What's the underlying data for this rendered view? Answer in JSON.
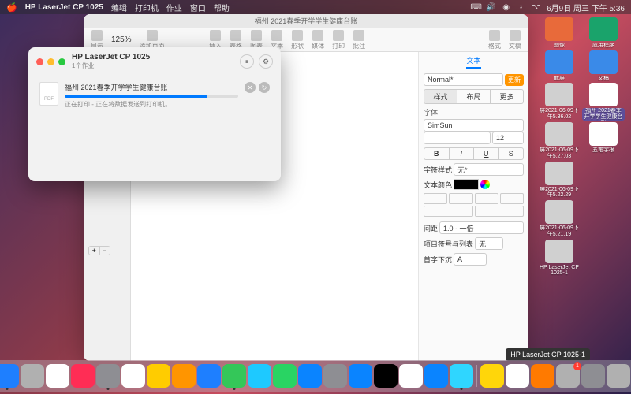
{
  "menubar": {
    "app": "HP LaserJet CP 1025",
    "menus": [
      "编辑",
      "打印机",
      "作业",
      "窗口",
      "帮助"
    ],
    "date": "6月9日 周三 下午 5:36"
  },
  "pages": {
    "title": "福州 2021春季开学学生健康台账",
    "zoom": "125%",
    "toolbar": [
      "显示",
      "125%",
      "添加页面",
      "插入",
      "表格",
      "图表",
      "文本",
      "形状",
      "媒体",
      "打印",
      "批注",
      "格式",
      "文稿"
    ],
    "inspector": {
      "top_tab": "文本",
      "style": "Normal*",
      "update": "更新",
      "tabs": [
        "样式",
        "布局",
        "更多"
      ],
      "font_label": "字体",
      "font_family": "SimSun",
      "font_size": "12",
      "char_style_label": "字符样式",
      "char_style_value": "无*",
      "color_label": "文本颜色",
      "spacing_label": "间距",
      "spacing_value": "1.0 - 一倍",
      "bullets_label": "项目符号与列表",
      "bullets_value": "无",
      "dropcap_label": "首字下沉"
    }
  },
  "print_queue": {
    "printer": "HP LaserJet CP 1025",
    "count": "1个作业",
    "job_name": "福州 2021春季开学学生健康台账",
    "job_status": "正在打印 - 正在将数据发送到打印机。"
  },
  "desktop": {
    "items": [
      {
        "label": "图像",
        "c": "#e86a3a"
      },
      {
        "label": "应用程序",
        "c": "#1aa36b"
      },
      {
        "label": "截屏",
        "c": "#3a8ae8"
      },
      {
        "label": "文稿",
        "c": "#3a8ae8"
      },
      {
        "label": "屏2021-06-09下午5.36.02",
        "c": "#d0d0d0"
      },
      {
        "label": "福州 2021春季开学学生健康台账",
        "c": "#ffffff",
        "sel": true
      },
      {
        "label": "屏2021-06-09下午5.27.03",
        "c": "#d0d0d0"
      },
      {
        "label": "五笔字根",
        "c": "#ffffff"
      },
      {
        "label": "屏2021-06-09下午5.22.29",
        "c": "#d0d0d0"
      },
      {
        "label": "",
        "c": ""
      },
      {
        "label": "屏2021-06-09下午5.21.19",
        "c": "#d0d0d0"
      },
      {
        "label": "",
        "c": ""
      },
      {
        "label": "HP LaserJet CP 1025-1",
        "c": "#d0d0d0"
      }
    ]
  },
  "tooltip": "HP LaserJet CP 1025-1",
  "dock_colors": [
    "#e8e8e8",
    "#1e7fff",
    "#b0b0b0",
    "#ffffff",
    "#ff2d55",
    "#8e8e93",
    "#ffffff",
    "#ffcc00",
    "#ff9500",
    "#1e7fff",
    "#34c759",
    "#1ec9ff",
    "#29d463",
    "#0a84ff",
    "#8e8e93",
    "#0a84ff",
    "#000000",
    "#ffffff",
    "#0a84ff",
    "#2fd6ff",
    "#ffd60a",
    "#ffffff",
    "#ff7a00",
    "#b0b0b0",
    "#8e8e93",
    "#b0b0b0"
  ]
}
